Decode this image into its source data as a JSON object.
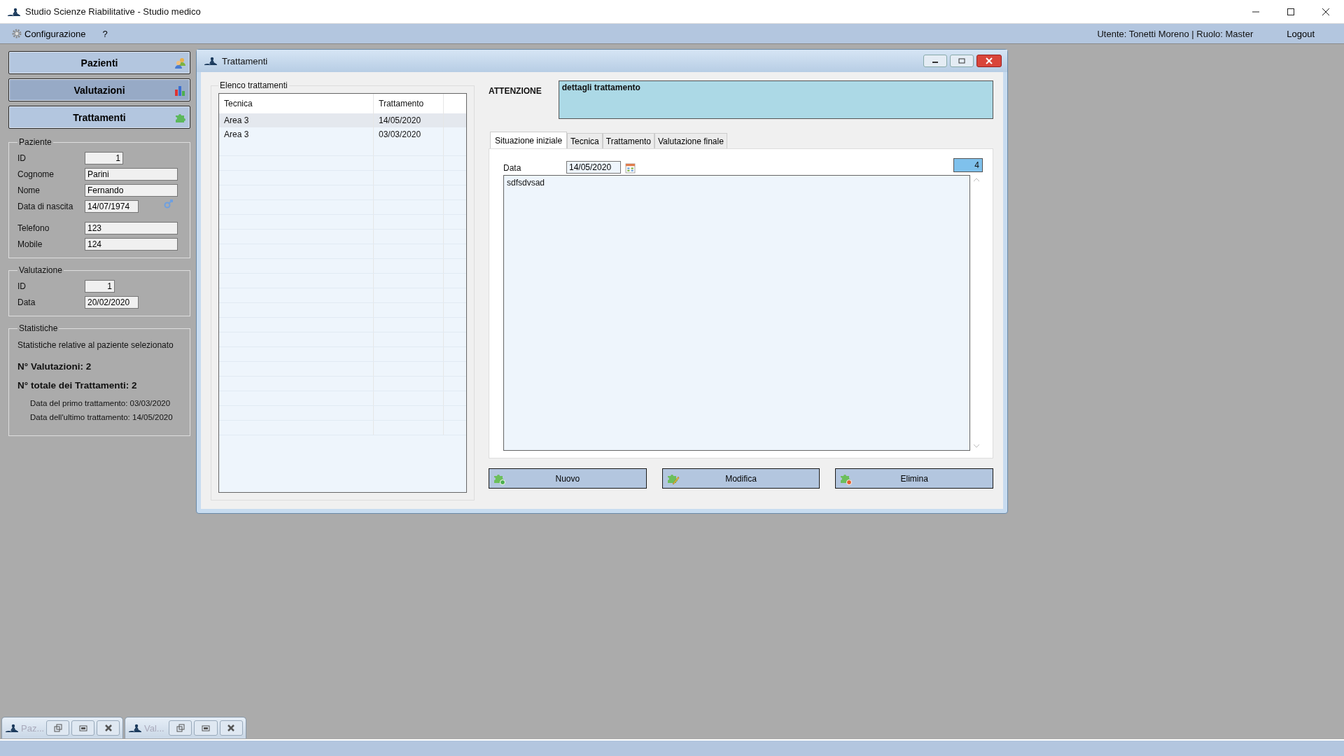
{
  "window": {
    "title": "Studio Scienze Riabilitative - Studio medico"
  },
  "menu": [
    {
      "label": "Configurazione",
      "kind": "settings"
    },
    {
      "label": "?",
      "kind": "plain"
    }
  ],
  "user_info": "Utente: Tonetti Moreno | Ruolo: Master",
  "logout": "Logout",
  "nav": [
    {
      "label": "Pazienti",
      "kind": "people",
      "selected": false
    },
    {
      "label": "Valutazioni",
      "kind": "chart",
      "selected": true
    },
    {
      "label": "Trattamenti",
      "kind": "puzzle",
      "selected": false
    }
  ],
  "paziente": {
    "title": "Paziente",
    "fields": [
      {
        "label": "ID",
        "value": "1",
        "kind": "id"
      },
      {
        "label": "Cognome",
        "value": "Parini",
        "kind": "text"
      },
      {
        "label": "Nome",
        "value": "Fernando",
        "kind": "text"
      },
      {
        "label": "Data di nascita",
        "value": "14/07/1974",
        "kind": "date"
      },
      {
        "label": "Telefono",
        "value": "123",
        "kind": "text"
      },
      {
        "label": "Mobile",
        "value": "124",
        "kind": "text"
      }
    ]
  },
  "valutazione": {
    "title": "Valutazione",
    "fields": [
      {
        "label": "ID",
        "value": "1",
        "kind": "id"
      },
      {
        "label": "Data",
        "value": "20/02/2020",
        "kind": "plain-date"
      }
    ]
  },
  "statistiche": {
    "title": "Statistiche",
    "subtitle": "Statistiche relative al paziente selezionato",
    "valutazioni": "N° Valutazioni: 2",
    "trattamenti": "N° totale dei Trattamenti: 2",
    "primo": "Data del primo trattamento: 03/03/2020",
    "ultimo": "Data dell'ultimo trattamento: 14/05/2020"
  },
  "trattamenti_window": {
    "title": "Trattamenti",
    "list_title": "Elenco trattamenti",
    "columns": [
      "Tecnica",
      "Trattamento"
    ],
    "rows": [
      {
        "cells": [
          "Area 3",
          "14/05/2020"
        ],
        "selected": true
      },
      {
        "cells": [
          "Area 3",
          "03/03/2020"
        ],
        "selected": false
      }
    ],
    "attention_label": "ATTENZIONE",
    "attention_text": "dettagli trattamento",
    "tabs": [
      {
        "label": "Situazione iniziale",
        "selected": true
      },
      {
        "label": "Tecnica",
        "selected": false
      },
      {
        "label": "Trattamento",
        "selected": false
      },
      {
        "label": "Valutazione finale",
        "selected": false
      }
    ],
    "date_label": "Data",
    "date_value": "14/05/2020",
    "counter": "4",
    "notes": "sdfsdvsad",
    "buttons": [
      {
        "label": "Nuovo",
        "kind": "add"
      },
      {
        "label": "Modifica",
        "kind": "edit"
      },
      {
        "label": "Elimina",
        "kind": "delete"
      }
    ]
  },
  "minimized": [
    {
      "title": "Paz..."
    },
    {
      "title": "Val..."
    }
  ]
}
